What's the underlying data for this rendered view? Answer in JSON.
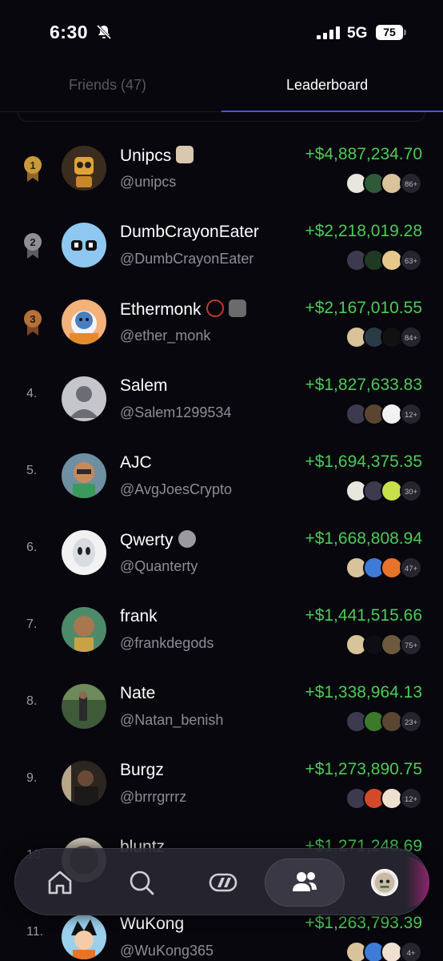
{
  "status_bar": {
    "time": "6:30",
    "network": "5G",
    "battery": "75"
  },
  "tabs": [
    {
      "label": "Friends (47)",
      "active": false
    },
    {
      "label": "Leaderboard",
      "active": true
    }
  ],
  "colors": {
    "accent": "#4750e6",
    "profit": "#4ccb58",
    "gold": "#c99a3c",
    "silver": "#8e8e93",
    "bronze": "#b4713a"
  },
  "leaderboard": [
    {
      "rank": "1",
      "medal": "gold",
      "name": "Unipcs",
      "handle": "@unipcs",
      "amount": "+$4,887,234.70",
      "badges": [
        "nft-badge"
      ],
      "holdings_count": "86+"
    },
    {
      "rank": "2",
      "medal": "silver",
      "name": "DumbCrayonEater",
      "handle": "@DumbCrayonEater",
      "amount": "+$2,218,019.28",
      "badges": [],
      "holdings_count": "63+"
    },
    {
      "rank": "3",
      "medal": "bronze",
      "name": "Ethermonk",
      "handle": "@ether_monk",
      "amount": "+$2,167,010.55",
      "badges": [
        "rope-badge",
        "nft-badge"
      ],
      "holdings_count": "84+"
    },
    {
      "rank": "4.",
      "name": "Salem",
      "handle": "@Salem1299534",
      "amount": "+$1,827,633.83",
      "badges": [],
      "holdings_count": "12+"
    },
    {
      "rank": "5.",
      "name": "AJC",
      "handle": "@AvgJoesCrypto",
      "amount": "+$1,694,375.35",
      "badges": [],
      "holdings_count": "30+"
    },
    {
      "rank": "6.",
      "name": "Qwerty",
      "handle": "@Quanterty",
      "amount": "+$1,668,808.94",
      "badges": [
        "token-badge"
      ],
      "holdings_count": "47+"
    },
    {
      "rank": "7.",
      "name": "frank",
      "handle": "@frankdegods",
      "amount": "+$1,441,515.66",
      "badges": [],
      "holdings_count": "75+"
    },
    {
      "rank": "8.",
      "name": "Nate",
      "handle": "@Natan_benish",
      "amount": "+$1,338,964.13",
      "badges": [],
      "holdings_count": "23+"
    },
    {
      "rank": "9.",
      "name": "Burgz",
      "handle": "@brrrgrrrz",
      "amount": "+$1,273,890.75",
      "badges": [],
      "holdings_count": "12+"
    },
    {
      "rank": "10.",
      "name": "bluntz",
      "handle": "",
      "amount": "+$1,271,248.69",
      "badges": [],
      "holdings_count": ""
    },
    {
      "rank": "11.",
      "name": "WuKong",
      "handle": "@WuKong365",
      "amount": "+$1,263,793.39",
      "badges": [],
      "holdings_count": "4+"
    }
  ],
  "bottom_nav": [
    {
      "icon": "home-icon"
    },
    {
      "icon": "search-icon"
    },
    {
      "icon": "feed-icon"
    },
    {
      "icon": "friends-icon",
      "active": true
    },
    {
      "icon": "profile-avatar"
    }
  ]
}
